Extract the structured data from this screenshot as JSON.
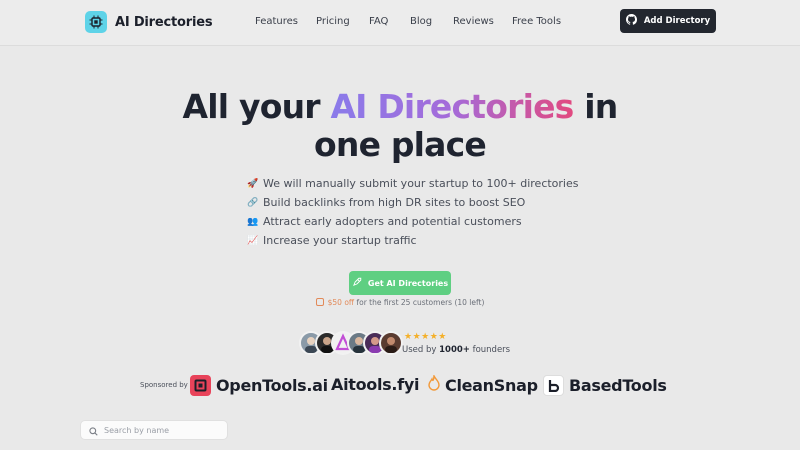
{
  "header": {
    "logo_text": "AI Directories",
    "nav": [
      "Features",
      "Pricing",
      "FAQ",
      "Blog",
      "Reviews",
      "Free Tools"
    ],
    "add_button": "Add Directory"
  },
  "hero": {
    "title_part1": "All your ",
    "title_highlight": "AI Directories",
    "title_part2": " in",
    "title_line2": "one place",
    "features": [
      {
        "icon": "rocket-icon",
        "text": "We will manually submit your startup to 100+ directories"
      },
      {
        "icon": "link-icon",
        "text": "Build backlinks from high DR sites to boost SEO"
      },
      {
        "icon": "users-icon",
        "text": "Attract early adopters and potential customers"
      },
      {
        "icon": "chart-icon",
        "text": "Increase your startup traffic"
      }
    ],
    "cta_label": "Get AI Directories",
    "promo_off": "$50 off",
    "promo_rest": " for the first 25 customers (10 left)",
    "stars": "★★★★★",
    "used_prefix": "Used by ",
    "used_count": "1000+",
    "used_suffix": " founders"
  },
  "sponsors": {
    "label": "Sponsored by",
    "items": [
      "OpenTools.ai",
      "Aitools.fyi",
      "CleanSnap",
      "BasedTools"
    ]
  },
  "search": {
    "placeholder": "Search by name"
  },
  "colors": {
    "cta": "#5fcf82",
    "accent_gradient_start": "#8a7bea",
    "accent_gradient_end": "#e2497f",
    "button_dark": "#23272f"
  }
}
